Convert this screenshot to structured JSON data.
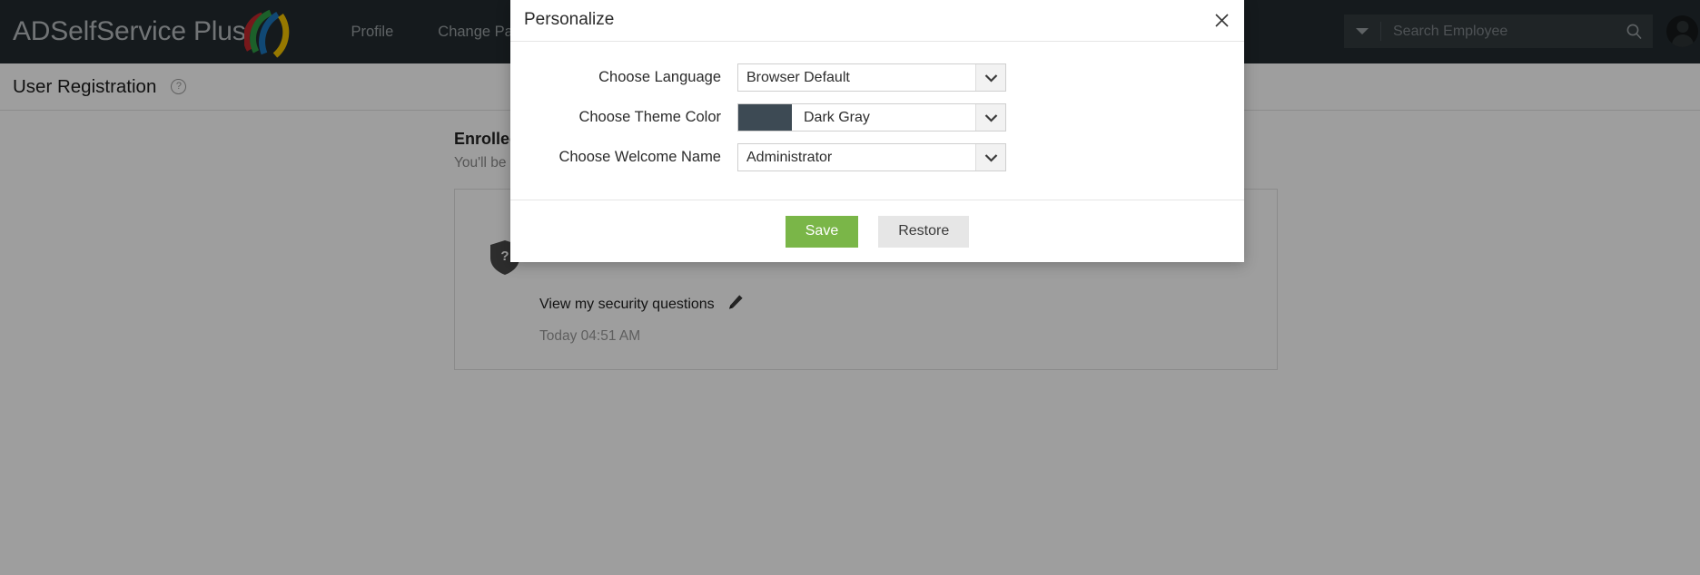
{
  "app": {
    "brand_name": "ADSelfService Plus",
    "nav": [
      {
        "label": "Profile"
      },
      {
        "label": "Change Password"
      }
    ],
    "search": {
      "placeholder": "Search Employee",
      "value": "",
      "caret_icon": "chevron-down-icon",
      "search_icon": "search-icon"
    },
    "avatar_icon": "user-avatar-icon"
  },
  "page": {
    "title": "User Registration",
    "help_icon_glyph": "?"
  },
  "content": {
    "enrolled_heading": "Enrolled",
    "enrolled_subtext": "You'll be",
    "card": {
      "shield_icon": "shield-question-icon",
      "link_label": "View my security questions",
      "edit_icon": "pencil-icon",
      "timestamp": "Today 04:51 AM"
    }
  },
  "modal": {
    "title": "Personalize",
    "close_icon": "close-icon",
    "fields": [
      {
        "label": "Choose Language",
        "value": "Browser Default",
        "name": "language-select",
        "has_swatch": false,
        "swatch_color": ""
      },
      {
        "label": "Choose Theme Color",
        "value": "Dark Gray",
        "name": "theme-color-select",
        "has_swatch": true,
        "swatch_color": "#3d4a54"
      },
      {
        "label": "Choose Welcome Name",
        "value": "Administrator",
        "name": "welcome-name-select",
        "has_swatch": false,
        "swatch_color": ""
      }
    ],
    "save_label": "Save",
    "restore_label": "Restore"
  },
  "colors": {
    "topbar": "#232b2f",
    "accent_green": "#7ab648",
    "theme_swatch": "#3d4a54",
    "neutral_button": "#e6e6e6"
  }
}
